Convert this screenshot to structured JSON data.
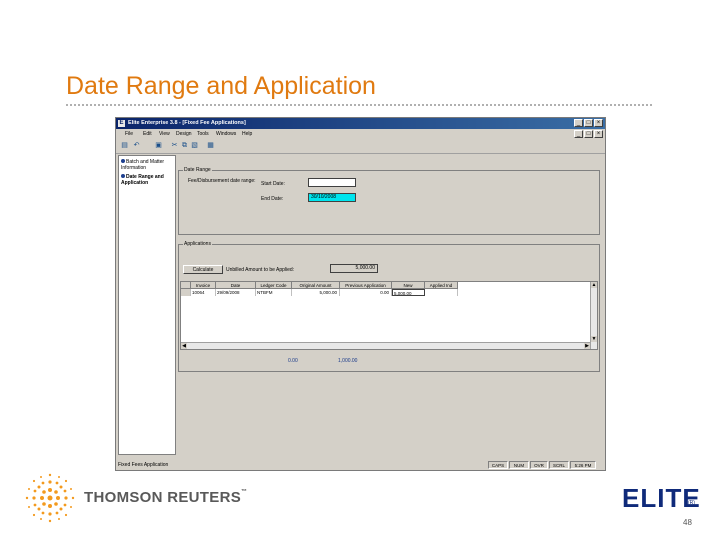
{
  "slide": {
    "title": "Date Range and Application",
    "page_number": "48",
    "footer_brand": "THOMSON REUTERS",
    "footer_brand_tm": "™",
    "elite_logo": "ELITE",
    "elite_mark": "(R)"
  },
  "app": {
    "title": "Elite Enterprise 3.8 - [Fixed Fee Applications]",
    "icon_letter": "E",
    "window_buttons": [
      "_",
      "□",
      "×"
    ],
    "menu": [
      "File",
      "Edit",
      "View",
      "Design",
      "Tools",
      "Windows",
      "Help"
    ],
    "toolbar_icons": [
      "save-icon",
      "undo-icon",
      "print-icon",
      "cut-icon",
      "copy-icon",
      "paste-icon",
      "report-icon"
    ],
    "nav": [
      {
        "label": "Batch and Matter Information",
        "active": false
      },
      {
        "label": "Date Range and Application",
        "active": true
      }
    ],
    "date_range": {
      "group_label": "Date Range",
      "hint": "Fee/Disbursement date range:",
      "start_label": "Start Date:",
      "start_value": "",
      "end_label": "End Date:",
      "end_value": "30/10/2008"
    },
    "applications": {
      "group_label": "Applications",
      "calculate_label": "Calculate",
      "unbilled_label": "Unbilled Amount to be Applied:",
      "unbilled_value": "5,000.00",
      "columns": [
        "Invoice",
        "Date",
        "Ledger Code",
        "Original Amount",
        "Previous Application",
        "New",
        "Applied Ind"
      ],
      "rows": [
        [
          "10064",
          "29/09/2008",
          "NTBFM",
          "5,000.00",
          "0.00",
          "5,000.00",
          ""
        ]
      ],
      "total_previous": "0.00",
      "total_new": "1,000.00"
    },
    "status": {
      "text": "Fixed Fees Application",
      "panes": [
        "CAPS",
        "NUM",
        "OVR",
        "SCRL",
        "5:26 PM"
      ]
    },
    "colors": {
      "titlebar": "#0a246a",
      "highlight": "#00e5ee"
    }
  }
}
